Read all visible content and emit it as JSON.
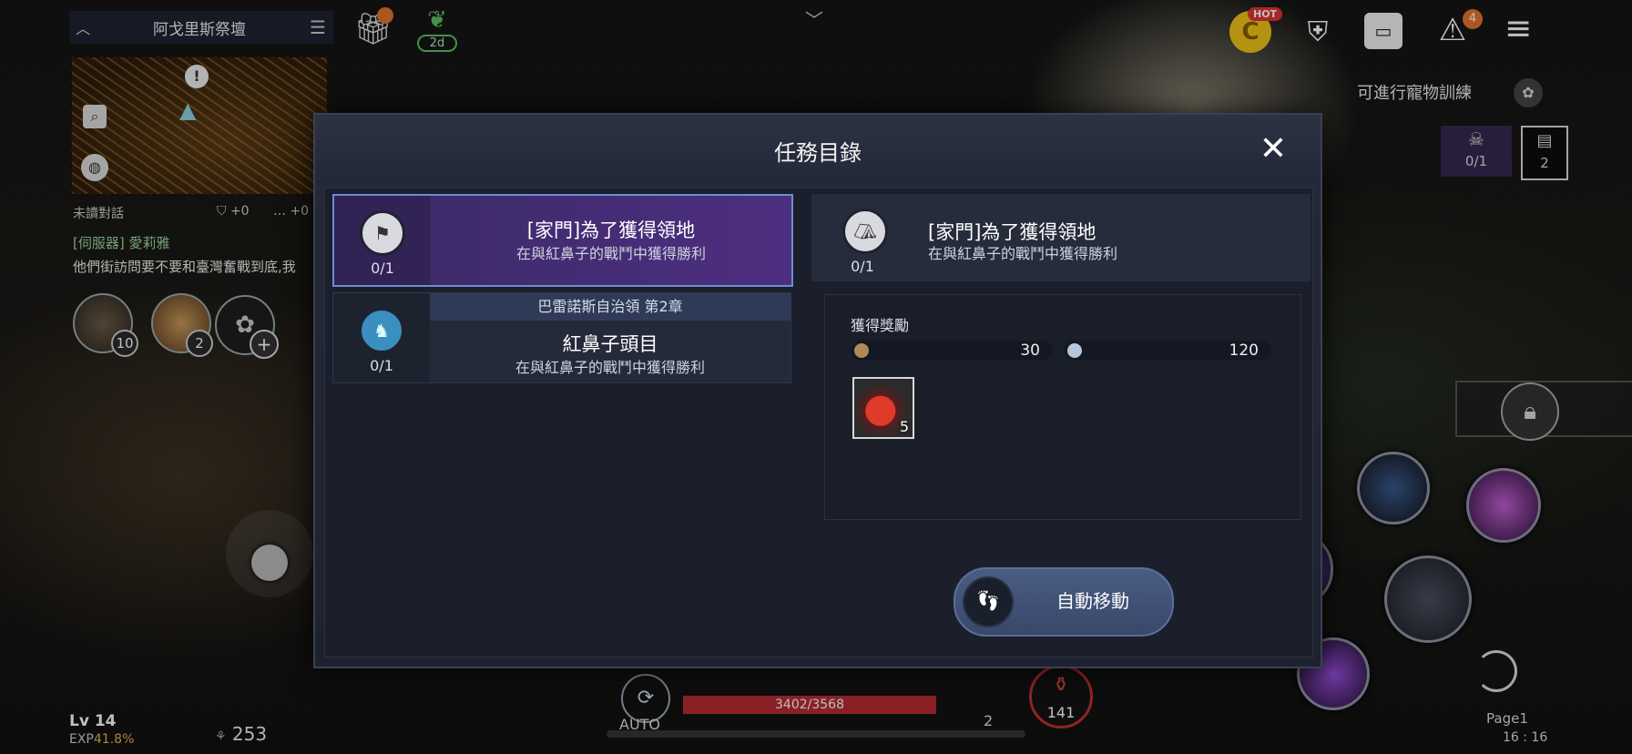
{
  "hud": {
    "zone_name": "阿戈里斯祭壇",
    "sprout_days": "2d",
    "chat_unread_label": "未讀對話",
    "chat_shield_count": "+0",
    "chat_msg_count": "+0",
    "chat_server_tag": "[伺服器] 愛莉雅",
    "chat_message": "他們街訪問要不要和臺灣奮戰到底,我",
    "pets": [
      {
        "count": "10"
      },
      {
        "count": "2"
      }
    ],
    "hot_badge": "HOT",
    "alert_count": "4",
    "pet_training": "可進行寵物訓練",
    "quest_mini_progress": "0/1",
    "quest_mini_count": "2",
    "level": "Lv 14",
    "exp_label": "EXP",
    "exp_value": "41.8%",
    "stat_value": "253",
    "hp": "3402/3568",
    "auto_label": "AUTO",
    "slot_count": "2",
    "potion_count": "141",
    "page_label": "Page1",
    "clock": "16 : 16"
  },
  "modal": {
    "title": "任務目錄",
    "quests": [
      {
        "progress": "0/1",
        "title": "[家門]為了獲得領地",
        "desc": "在與紅鼻子的戰鬥中獲得勝利"
      },
      {
        "chapter": "巴雷諾斯自治領 第2章",
        "progress": "0/1",
        "title": "紅鼻子頭目",
        "desc": "在與紅鼻子的戰鬥中獲得勝利"
      }
    ],
    "detail": {
      "progress": "0/1",
      "title": "[家門]為了獲得領地",
      "desc": "在與紅鼻子的戰鬥中獲得勝利",
      "reward_label": "獲得獎勵",
      "exp_reward": "30",
      "silver_reward": "120",
      "item_count": "5"
    },
    "auto_move_label": "自動移動"
  },
  "colors": {
    "accent_purple": "#4d2e80",
    "hp_red": "#b92d35",
    "exp_gold": "#e6b34a"
  }
}
